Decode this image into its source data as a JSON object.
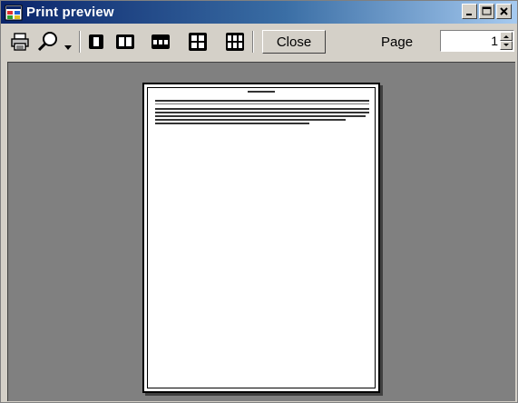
{
  "window": {
    "title": "Print preview"
  },
  "toolbar": {
    "print_icon": "printer-icon",
    "zoom_icon": "magnifier-icon",
    "zoom_dropdown_icon": "chevron-down-icon",
    "layout_icons": [
      "one-page-icon",
      "two-pages-icon",
      "three-pages-icon",
      "four-pages-icon",
      "six-pages-icon"
    ],
    "close_label": "Close",
    "page_label": "Page",
    "page_value": "1"
  },
  "colors": {
    "title_gradient_start": "#0a246a",
    "title_gradient_end": "#a6caf0",
    "preview_background": "#808080",
    "chrome": "#d4d0c8"
  }
}
